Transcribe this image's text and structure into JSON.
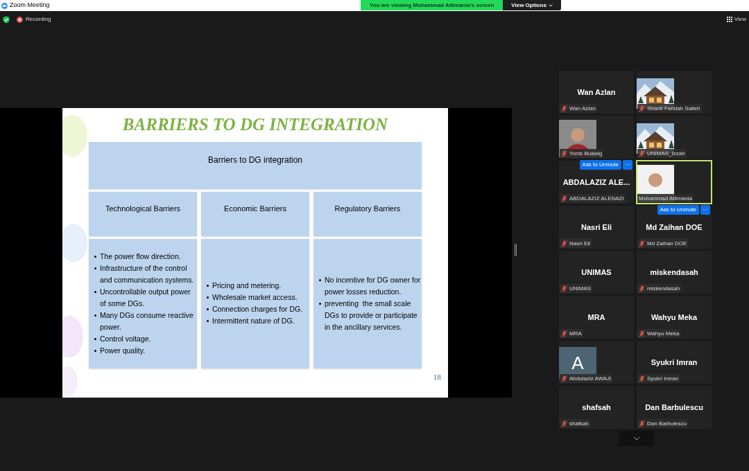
{
  "window": {
    "title": "Zoom Meeting"
  },
  "banner": {
    "text": "You are viewing Mohammad Altimania's screen",
    "options": "View Options"
  },
  "toolbar": {
    "recording": "Recording",
    "view": "View"
  },
  "slide": {
    "title": "BARRIERS TO DG INTEGRATION",
    "header": "Barriers to DG integration",
    "page": "18",
    "columns": [
      {
        "heading": "Technological Barriers",
        "items": [
          "The power flow direction.",
          "Infrastructure of the control and communication systems.",
          "Uncontrollable output power of some DGs.",
          "Many DGs consume reactive power.",
          "Control voltage.",
          "Power quality."
        ]
      },
      {
        "heading": "Economic Barriers",
        "items": [
          "Pricing and metering.",
          "Wholesale market access.",
          "Connection charges for DG.",
          "Intermittent nature of DG."
        ]
      },
      {
        "heading": "Regulatory Barriers",
        "items": [
          "No incentive for DG owner for power losses reduction.",
          "preventing  the small scale DGs to provide or participate in the ancillary services."
        ]
      }
    ]
  },
  "participants": [
    {
      "kind": "name",
      "display_name": "Wan Azlan",
      "label": "Wan Azlan",
      "muted": true,
      "speaking": false
    },
    {
      "kind": "chalet",
      "label": "Shanti Faridah Salleh",
      "muted": true,
      "speaking": false
    },
    {
      "kind": "person",
      "label": "Yonis Buswig",
      "muted": true,
      "speaking": false
    },
    {
      "kind": "chalet",
      "label": "UNIMAS_Izzah",
      "muted": true,
      "speaking": false
    },
    {
      "kind": "name",
      "display_name": "ABDALAZIZ ALE...",
      "label": "ABDALAZIZ ALENAZI",
      "muted": true,
      "speaking": false,
      "unmute": "Ask to Unmute",
      "more": "···"
    },
    {
      "kind": "person",
      "label": "Mohammad Altimania",
      "muted": false,
      "speaking": true
    },
    {
      "kind": "name",
      "display_name": "Nasri Eli",
      "label": "Nasri Eli",
      "muted": true,
      "speaking": false
    },
    {
      "kind": "name",
      "display_name": "Md Zaihan DOE",
      "label": "Md Zaihan DOE",
      "muted": true,
      "speaking": false,
      "unmute": "Ask to Unmute",
      "more": "···"
    },
    {
      "kind": "name",
      "display_name": "UNIMAS",
      "label": "UNIMAS",
      "muted": true,
      "speaking": false
    },
    {
      "kind": "name",
      "display_name": "miskendasah",
      "label": "miskendasah",
      "muted": true,
      "speaking": false
    },
    {
      "kind": "name",
      "display_name": "MRA",
      "label": "MRA",
      "muted": true,
      "speaking": false
    },
    {
      "kind": "name",
      "display_name": "Wahyu Meka",
      "label": "Wahyu Meka",
      "muted": true,
      "speaking": false
    },
    {
      "kind": "initial",
      "initial": "A",
      "label": "Abdulaziz AWAJI",
      "muted": true,
      "speaking": false
    },
    {
      "kind": "name",
      "display_name": "Syukri Imran",
      "label": "Syukri Imran",
      "muted": true,
      "speaking": false
    },
    {
      "kind": "name",
      "display_name": "shafsah",
      "label": "shafsah",
      "muted": true,
      "speaking": false
    },
    {
      "kind": "name",
      "display_name": "Dan Barbulescu",
      "label": "Dan Barbulescu",
      "muted": true,
      "speaking": false
    }
  ]
}
